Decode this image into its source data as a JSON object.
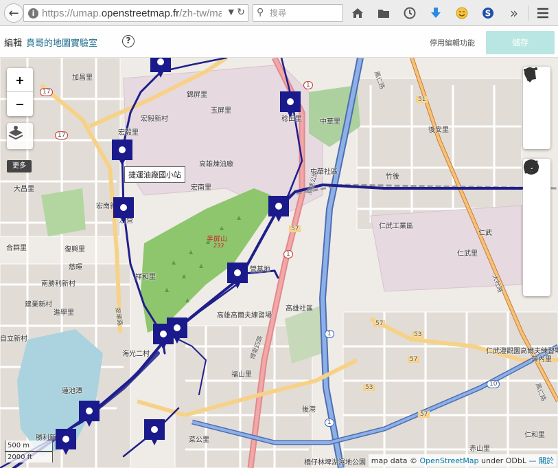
{
  "browser": {
    "url_prefix": "https://umap.",
    "url_domain": "openstreetmap.fr",
    "url_suffix": "/zh-tw/ma",
    "search_placeholder": "搜尋",
    "icons": [
      "back-icon",
      "home-icon",
      "folder-icon",
      "history-icon",
      "download-icon",
      "emoji-icon",
      "s-extension-icon",
      "overflow-icon",
      "menu-icon"
    ]
  },
  "header": {
    "edit_label": "編輯",
    "map_title": "賁哥的地圖實驗室",
    "help_label": "?",
    "disable_edit": "停用編輯功能",
    "save": "儲存"
  },
  "map_controls": {
    "zoom_in": "+",
    "zoom_out": "−",
    "more": "更多"
  },
  "tooltip": "捷運油廠國小站",
  "labels": {
    "l0": "加昌里",
    "l1": "錦屏里",
    "l2": "玉屏里",
    "l3": "稔田里",
    "l4": "中華里",
    "l5": "宏毅新村",
    "l6": "宏毅里",
    "l7": "高雄煉油廠",
    "l8": "宏南里",
    "l9": "宏南新村",
    "l10": "大昌里",
    "l11": "後安里",
    "l12": "竹後",
    "l13": "仁武工業區",
    "l14": "仁武里",
    "l15": "半屏山",
    "l16": "233",
    "l17": "祥和里",
    "l18": "合群里",
    "l19": "復興里",
    "l20": "慈暉",
    "l21": "南勝利新村",
    "l22": "建業新村",
    "l23": "進學里",
    "l24": "自立新村",
    "l25": "海光二村",
    "l26": "高雄高爾夫練習場",
    "l27": "福山里",
    "l28": "蓮池潭",
    "l29": "勝利新村",
    "l30": "菜公里",
    "l31": "後港",
    "l32": "仁武澄觀園高爾夫練習場",
    "l33": "灣內里",
    "l34": "仁和里",
    "l35": "赤山里",
    "l36": "橋仔林埤湖濕地公園",
    "l37": "高雄社區",
    "l38": "中華社區",
    "l39": "營基地",
    "l40": "仁武",
    "l41": "左營",
    "r0": "17",
    "r1": "17",
    "r2": "1",
    "r3": "1",
    "r4": "1",
    "r5": "57",
    "r6": "57",
    "r7": "51",
    "r8": "53",
    "r9": "53",
    "r10": "57",
    "r11": "57",
    "r12": "10",
    "r13": "1",
    "r14": "1",
    "r15": "高速公路",
    "r16": "翠華路",
    "r17": "博愛四路",
    "r18": "鳳仁路",
    "r19": "鳳仁路",
    "r20": "大社路"
  },
  "scale": {
    "metric": "500 m",
    "imperial": "2000 ft"
  },
  "attribution": {
    "prefix": "map data ©",
    "osm": "OpenStreetMap",
    "mid": "under ODbL",
    "sep": "—",
    "about": "關於"
  },
  "colors": {
    "route": "#1f1f8c",
    "marker": "#1a1a8c",
    "highway_blue": "#7b9fd9",
    "road_red": "#e3898b",
    "park_green": "#78b65f",
    "industrial": "#ddd0db"
  }
}
